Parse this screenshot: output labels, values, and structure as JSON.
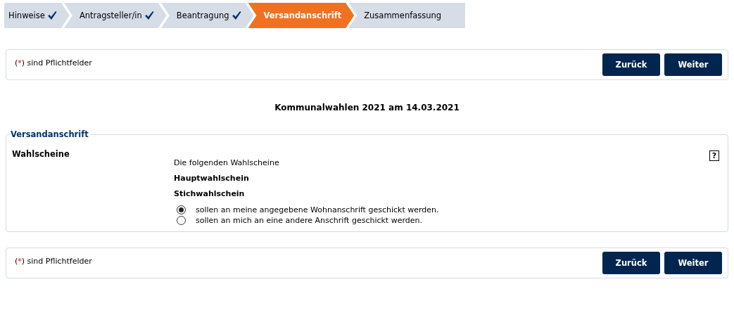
{
  "steps": [
    {
      "label": "Hinweise",
      "completed": true,
      "selected": false
    },
    {
      "label": "Antragsteller/in",
      "completed": true,
      "selected": false
    },
    {
      "label": "Beantragung",
      "completed": true,
      "selected": false
    },
    {
      "label": "Versandanschrift",
      "completed": false,
      "selected": true
    },
    {
      "label": "Zusammenfassung",
      "completed": false,
      "selected": false
    }
  ],
  "top_bar": {
    "note": {
      "before": "(",
      "mark": "*",
      "after": ") sind Pflichtfelder"
    },
    "buttons": [
      "Zurück",
      "Weiter"
    ]
  },
  "heading": "Kommunalwahlen 2021 am 14.03.2021",
  "fieldset": {
    "legend": "Versandanschrift",
    "label": "Wahlscheine",
    "help": "?",
    "intro": "Die folgenden Wahlscheine",
    "ballots": [
      "Hauptwahlschein",
      "Stichwahlschein"
    ],
    "options": [
      {
        "label": "sollen an meine angegebene Wohnanschrift geschickt werden.",
        "selected": true
      },
      {
        "label": "sollen an mich an eine andere Anschrift geschickt werden.",
        "selected": false
      }
    ]
  },
  "bottom_bar": {
    "note": {
      "before": "(",
      "mark": "*",
      "after": ") sind Pflichtfelder"
    },
    "buttons": [
      "Zurück",
      "Weiter"
    ]
  }
}
